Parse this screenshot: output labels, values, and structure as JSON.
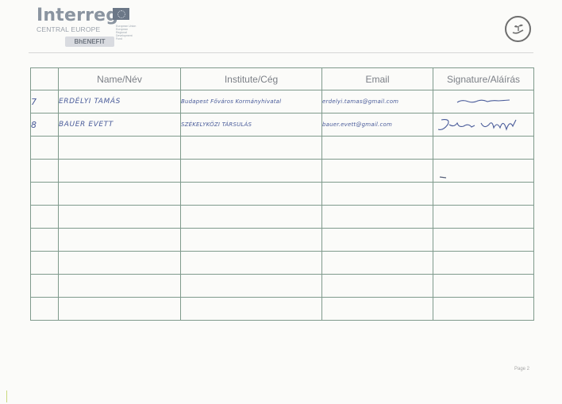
{
  "header": {
    "brand": "Interreg",
    "program": "CENTRAL EUROPE",
    "eu_text": "European Union European Regional Development Fund",
    "project": "BhENEFIT"
  },
  "table": {
    "columns": [
      "Name/Név",
      "Institute/Cég",
      "Email",
      "Signature/Aláírás"
    ],
    "rows": [
      {
        "num": "7",
        "name": "ERDÉLYI TAMÁS",
        "institute": "Budapest Főváros Kormányhivatal",
        "email": "erdelyi.tamas@gmail.com"
      },
      {
        "num": "8",
        "name": "BAUER EVETT",
        "institute": "SZÉKELYKÖZI TÁRSULÁS",
        "email": "bauer.evett@gmail.com"
      },
      {
        "num": "",
        "name": "",
        "institute": "",
        "email": ""
      },
      {
        "num": "",
        "name": "",
        "institute": "",
        "email": ""
      },
      {
        "num": "",
        "name": "",
        "institute": "",
        "email": ""
      },
      {
        "num": "",
        "name": "",
        "institute": "",
        "email": ""
      },
      {
        "num": "",
        "name": "",
        "institute": "",
        "email": ""
      },
      {
        "num": "",
        "name": "",
        "institute": "",
        "email": ""
      },
      {
        "num": "",
        "name": "",
        "institute": "",
        "email": ""
      },
      {
        "num": "",
        "name": "",
        "institute": "",
        "email": ""
      }
    ]
  },
  "footer": {
    "page": "Page 2"
  },
  "icons": {
    "top_right": "sprout-hand-icon",
    "eu_flag": "eu-flag-icon"
  },
  "colors": {
    "table_border": "#7f9a8c",
    "handwriting": "#4a5c9a"
  }
}
